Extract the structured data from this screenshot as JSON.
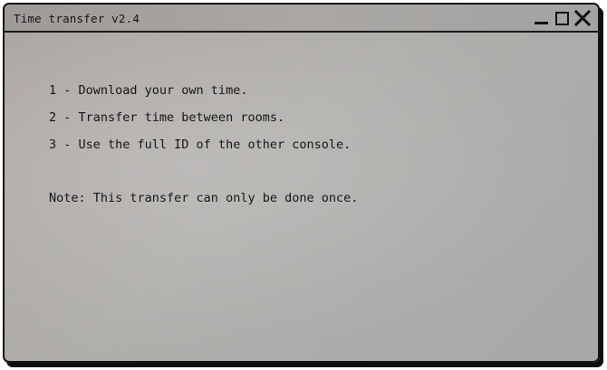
{
  "window": {
    "title": "Time transfer v2.4",
    "controls": {
      "minimize_icon": "minimize-icon",
      "maximize_icon": "maximize-icon",
      "close_icon": "close-icon"
    }
  },
  "content": {
    "steps": [
      "1 - Download your own time.",
      "2 - Transfer time between rooms.",
      "3 - Use the full ID of the other console."
    ],
    "note": "Note: This transfer can only be done once."
  },
  "colors": {
    "frame": "#141414",
    "background": "#aeaba8",
    "text": "#161616"
  }
}
